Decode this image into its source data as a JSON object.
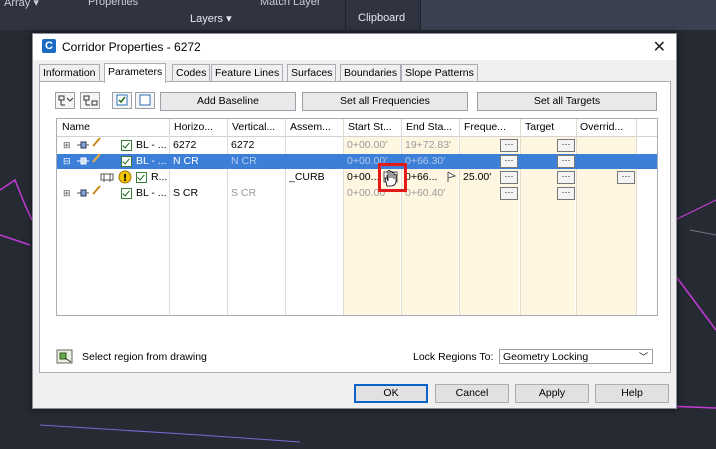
{
  "ribbon": {
    "fragment_left": "Array ▾",
    "fragment_props": "Properties",
    "fragment_match": "Match Layer",
    "layers_panel": "Layers ▾",
    "clipboard_panel": "Clipboard"
  },
  "dialog": {
    "title": "Corridor Properties - 6272",
    "app_icon": "C",
    "tabs": [
      "Information",
      "Parameters",
      "Codes",
      "Feature Lines",
      "Surfaces",
      "Boundaries",
      "Slope Patterns"
    ],
    "active_tab": "Parameters"
  },
  "toolbar": {
    "add_baseline": "Add Baseline",
    "set_all_frequencies": "Set all Frequencies",
    "set_all_targets": "Set all Targets"
  },
  "grid": {
    "columns": [
      "Name",
      "Horizo...",
      "Vertical...",
      "Assem...",
      "Start St...",
      "End Sta...",
      "Freque...",
      "Target",
      "Overrid..."
    ],
    "rows": [
      {
        "name": "BL - ...",
        "horizontal": "6272",
        "vertical": "6272",
        "assembly": "",
        "start": "0+00.00'",
        "end": "19+72.83'",
        "frequency": "",
        "selected": false
      },
      {
        "name": "BL - ...",
        "horizontal": "N CR",
        "vertical": "N CR",
        "assembly": "",
        "start": "0+00.00'",
        "end": "0+66.30'",
        "frequency": "",
        "selected": true
      },
      {
        "name": "R...",
        "horizontal": "",
        "vertical": "",
        "assembly": "_CURB",
        "start": "0+00...",
        "end": "0+66...",
        "frequency": "25.00'",
        "selected": false
      },
      {
        "name": "BL - ...",
        "horizontal": "S CR",
        "vertical": "S CR",
        "assembly": "",
        "start": "0+00.00'",
        "end": "0+60.40'",
        "frequency": "",
        "selected": false
      }
    ],
    "ellipsis": "···"
  },
  "bottom": {
    "select_region": "Select region from drawing",
    "lock_regions_label": "Lock Regions To:",
    "lock_regions_value": "Geometry Locking"
  },
  "buttons": {
    "ok": "OK",
    "cancel": "Cancel",
    "apply": "Apply",
    "help": "Help"
  },
  "colors": {
    "selection": "#3c7fd8",
    "highlight_box": "#e31b1b",
    "column_tint": "#fff6e2"
  }
}
